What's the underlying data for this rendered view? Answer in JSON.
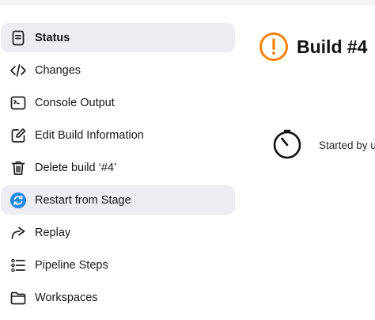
{
  "sidebar": {
    "items": [
      {
        "label": "Status",
        "icon": "document-icon"
      },
      {
        "label": "Changes",
        "icon": "code-icon"
      },
      {
        "label": "Console Output",
        "icon": "terminal-icon"
      },
      {
        "label": "Edit Build Information",
        "icon": "edit-icon"
      },
      {
        "label": "Delete build ‘#4’",
        "icon": "trash-icon"
      },
      {
        "label": "Restart from Stage",
        "icon": "restart-icon"
      },
      {
        "label": "Replay",
        "icon": "replay-icon"
      },
      {
        "label": "Pipeline Steps",
        "icon": "list-icon"
      },
      {
        "label": "Workspaces",
        "icon": "folder-icon"
      }
    ]
  },
  "build": {
    "title": "Build #4",
    "status_icon": "warning-icon",
    "status_color": "#fe820a",
    "started_text": "Started by u"
  },
  "colors": {
    "active_bg": "#ececf1",
    "restart_icon_bg": "#1e88e5"
  }
}
